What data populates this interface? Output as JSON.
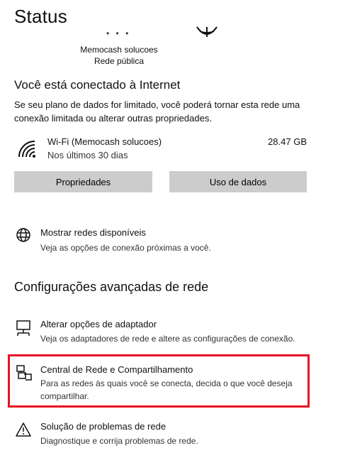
{
  "page": {
    "title": "Status"
  },
  "network": {
    "name": "Memocash solucoes",
    "type": "Rede pública"
  },
  "connection": {
    "heading": "Você está conectado à Internet",
    "description": "Se seu plano de dados for limitado, você poderá tornar esta rede uma conexão limitada ou alterar outras propriedades."
  },
  "wifi": {
    "name": "Wi-Fi (Memocash solucoes)",
    "period": "Nos últimos 30 dias",
    "usage": "28.47 GB"
  },
  "buttons": {
    "properties": "Propriedades",
    "data_usage": "Uso de dados"
  },
  "show_networks": {
    "title": "Mostrar redes disponíveis",
    "description": "Veja as opções de conexão próximas a você."
  },
  "advanced": {
    "heading": "Configurações avançadas de rede",
    "items": [
      {
        "title": "Alterar opções de adaptador",
        "description": "Veja os adaptadores de rede e altere as configurações de conexão."
      },
      {
        "title": "Central de Rede e Compartilhamento",
        "description": "Para as redes às quais você se conecta, decida o que você deseja compartilhar."
      },
      {
        "title": "Solução de problemas de rede",
        "description": "Diagnostique e corrija problemas de rede."
      }
    ]
  },
  "icons": {
    "wifi": "wifi-icon",
    "globe": "globe-icon",
    "adapter": "adapter-icon",
    "network_center": "network-center-icon",
    "warning": "warning-icon"
  },
  "colors": {
    "highlight": "#e81123",
    "button_bg": "#cccccc"
  }
}
